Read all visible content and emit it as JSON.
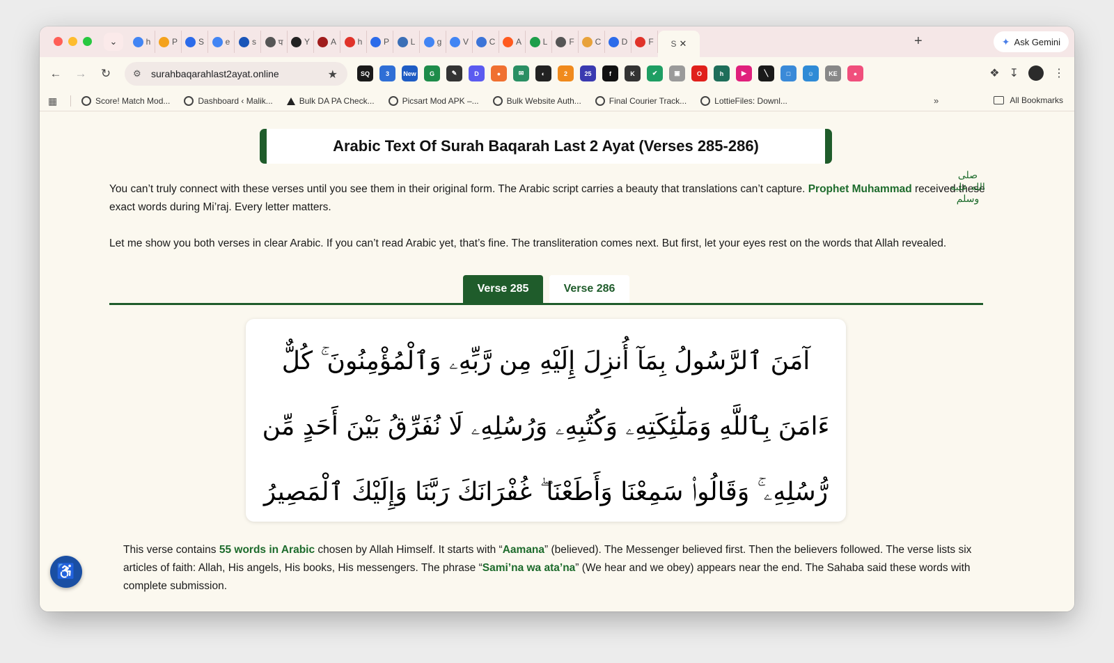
{
  "browser": {
    "tabs": [
      {
        "letter": "h",
        "icon": "google-icon",
        "color": "#4285f4"
      },
      {
        "letter": "P",
        "icon": "analytics-icon",
        "color": "#f4a21c"
      },
      {
        "letter": "S",
        "icon": "bing-icon",
        "color": "#2c6bea"
      },
      {
        "letter": "e",
        "icon": "google-icon",
        "color": "#4285f4"
      },
      {
        "letter": "s",
        "icon": "search-icon",
        "color": "#1a55b8"
      },
      {
        "letter": "प",
        "icon": "openai-icon",
        "color": "#555555"
      },
      {
        "letter": "Y",
        "icon": "dark-circle-icon",
        "color": "#222222"
      },
      {
        "letter": "A",
        "icon": "code-icon",
        "color": "#a01c1c"
      },
      {
        "letter": "h",
        "icon": "y-icon",
        "color": "#e0332a"
      },
      {
        "letter": "P",
        "icon": "gauge-icon",
        "color": "#2c6bea"
      },
      {
        "letter": "L",
        "icon": "gt-icon",
        "color": "#3b6fb6"
      },
      {
        "letter": "g",
        "icon": "google-icon",
        "color": "#4285f4"
      },
      {
        "letter": "V",
        "icon": "google-icon",
        "color": "#4285f4"
      },
      {
        "letter": "C",
        "icon": "diamond-icon",
        "color": "#3c74d8"
      },
      {
        "letter": "A",
        "icon": "n-icon",
        "color": "#ff5a1f"
      },
      {
        "letter": "L",
        "icon": "sheet-icon",
        "color": "#1e9e4a"
      },
      {
        "letter": "F",
        "icon": "openai-icon",
        "color": "#555555"
      },
      {
        "letter": "C",
        "icon": "rainbow-icon",
        "color": "#e8a23a"
      },
      {
        "letter": "D",
        "icon": "download-icon",
        "color": "#2c6bea"
      },
      {
        "letter": "F",
        "icon": "p-icon",
        "color": "#e0332a"
      }
    ],
    "active_tab": {
      "letter": "S"
    },
    "gemini_label": "Ask Gemini",
    "url": "surahbaqarahlast2ayat.online",
    "extensions": [
      {
        "label": "SQ",
        "color": "#1a1a1a"
      },
      {
        "label": "3",
        "color": "#2f6fd6"
      },
      {
        "label": "New",
        "color": "#1e5cc4"
      },
      {
        "label": "G",
        "color": "#1e8c4a"
      },
      {
        "label": "✎",
        "color": "#333333"
      },
      {
        "label": "D",
        "color": "#5b5bf0"
      },
      {
        "label": "●",
        "color": "#f07030"
      },
      {
        "label": "✉",
        "color": "#2a8f63"
      },
      {
        "label": "◐",
        "color": "#222222"
      },
      {
        "label": "2",
        "color": "#f08a1c"
      },
      {
        "label": "25",
        "color": "#3a3ab0"
      },
      {
        "label": "f",
        "color": "#111111"
      },
      {
        "label": "K",
        "color": "#333333"
      },
      {
        "label": "✔",
        "color": "#1e9e63"
      },
      {
        "label": "▣",
        "color": "#9a9a9a"
      },
      {
        "label": "O",
        "color": "#e0201c"
      },
      {
        "label": "h",
        "color": "#1e6e5a"
      },
      {
        "label": "▶",
        "color": "#e0207c"
      },
      {
        "label": "╲",
        "color": "#1a1a1a"
      },
      {
        "label": "□",
        "color": "#3a8ad8"
      },
      {
        "label": "☺",
        "color": "#2f8bd6"
      },
      {
        "label": "KE",
        "color": "#888888"
      },
      {
        "label": "●",
        "color": "#f04f7c"
      }
    ],
    "bookmarks": [
      {
        "label": "Score! Match Mod...",
        "icon": "globe-icon"
      },
      {
        "label": "Dashboard ‹ Malik...",
        "icon": "globe-icon"
      },
      {
        "label": "Bulk DA PA Check...",
        "icon": "triangle-icon"
      },
      {
        "label": "Picsart Mod APK –...",
        "icon": "globe-icon"
      },
      {
        "label": "Bulk Website Auth...",
        "icon": "globe-icon"
      },
      {
        "label": "Final Courier Track...",
        "icon": "globe-icon"
      },
      {
        "label": "LottieFiles: Downl...",
        "icon": "globe-icon"
      }
    ],
    "all_bookmarks_label": "All Bookmarks"
  },
  "page": {
    "heading": "Arabic Text Of Surah Baqarah Last 2 Ayat (Verses 285-286)",
    "p1_before": "You can’t truly connect with these verses until you see them in their original form. The Arabic script carries a beauty that translations can’t capture. ",
    "p1_link": "Prophet Muhammad",
    "p1_after": " received these exact words during Mi’raj. Every letter matters.",
    "salawat": "صلى الله عليه وسلم",
    "p2": "Let me show you both verses in clear Arabic. If you can’t read Arabic yet, that’s fine. The transliteration comes next. But first, let your eyes rest on the words that Allah revealed.",
    "verse_tabs": [
      "Verse 285",
      "Verse 286"
    ],
    "verse_285_arabic": "آمَنَ ٱلرَّسُولُ بِمَآ أُنزِلَ إِلَيْهِ مِن رَّبِّهِۦ وَٱلْمُؤْمِنُونَ ۚ كُلٌّ ءَامَنَ بِٱللَّهِ وَمَلَٰٓئِكَتِهِۦ وَكُتُبِهِۦ وَرُسُلِهِۦ لَا نُفَرِّقُ بَيْنَ أَحَدٍ مِّن رُّسُلِهِۦ ۚ وَقَالُوا۟ سَمِعْنَا وَأَطَعْنَا ۖ غُفْرَانَكَ رَبَّنَا وَإِلَيْكَ ٱلْمَصِيرُ",
    "p3_a": "This verse contains ",
    "p3_b": "55 words in Arabic",
    "p3_c": " chosen by Allah Himself. It starts with “",
    "p3_d": "Aamana",
    "p3_e": "” (believed). The Messenger believed first. Then the believers followed. The verse lists six articles of faith: Allah, His angels, His books, His messengers. The phrase “",
    "p3_f": "Sami’na wa ata’na",
    "p3_g": "” (We hear and we obey) appears near the end. The Sahaba said these words with complete submission.",
    "accent_color": "#1f5c2b"
  }
}
